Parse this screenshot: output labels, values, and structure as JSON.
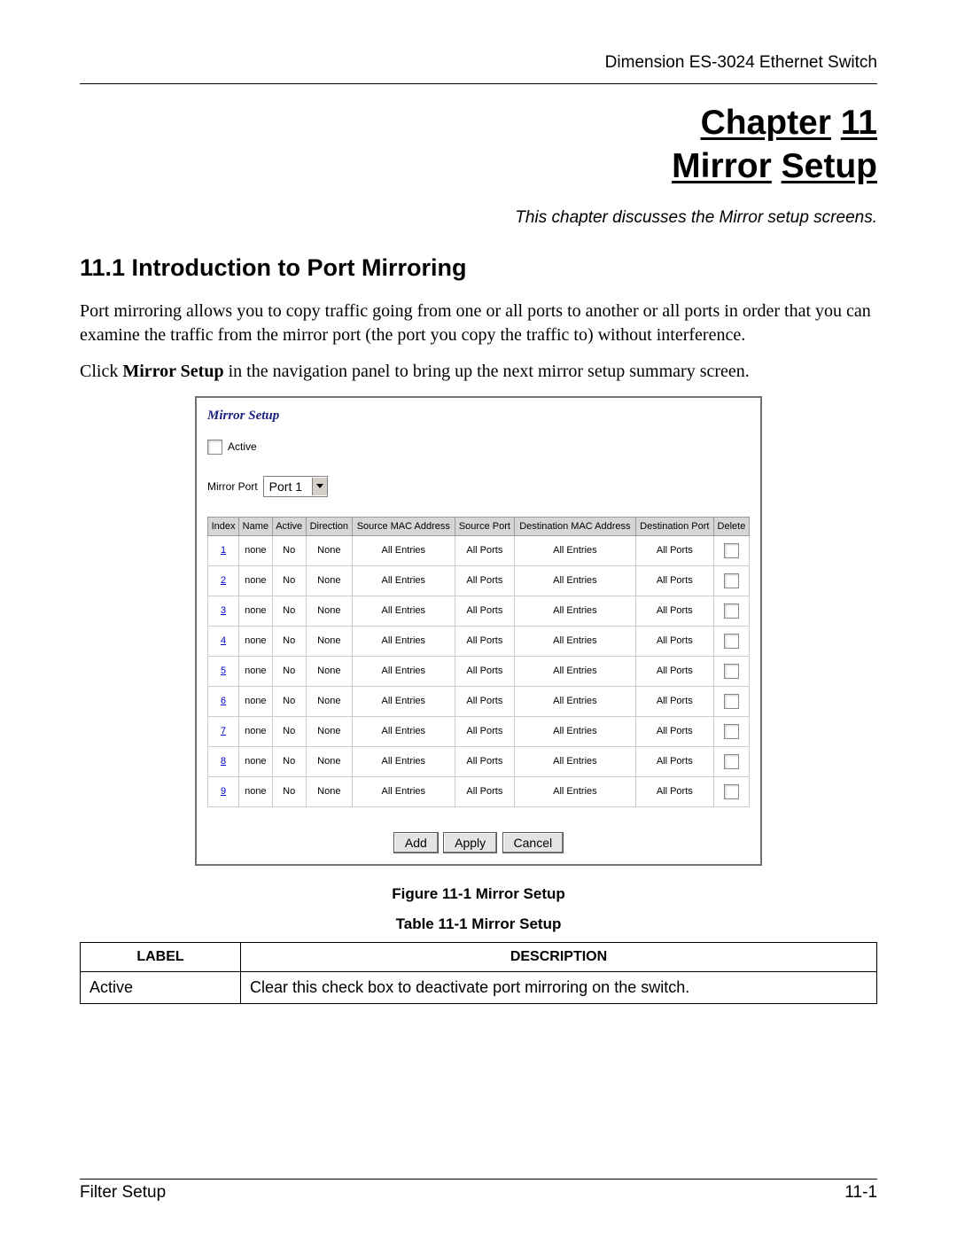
{
  "header": {
    "product": "Dimension ES-3024 Ethernet Switch"
  },
  "chapter": {
    "word_chapter": "Chapter",
    "number": "11",
    "title_a": "Mirror",
    "title_b": "Setup",
    "subtitle": "This chapter discusses the Mirror setup screens."
  },
  "section": {
    "heading": "11.1 Introduction to Port Mirroring",
    "p1": "Port mirroring allows you to copy traffic going from one or all ports to another or all ports in order that you can examine the traffic from the mirror port (the port you copy the traffic to) without interference.",
    "p2_pre": "Click ",
    "p2_bold": "Mirror Setup",
    "p2_post": " in the navigation panel to bring up the next mirror setup summary screen."
  },
  "screenshot": {
    "title": "Mirror Setup",
    "active_label": "Active",
    "mirror_port_label": "Mirror Port",
    "mirror_port_value": "Port 1",
    "columns": [
      "Index",
      "Name",
      "Active",
      "Direction",
      "Source MAC Address",
      "Source Port",
      "Destination MAC Address",
      "Destination Port",
      "Delete"
    ],
    "rows": [
      {
        "index": "1",
        "name": "none",
        "active": "No",
        "direction": "None",
        "srcmac": "All Entries",
        "srcport": "All Ports",
        "dstmac": "All Entries",
        "dstport": "All Ports"
      },
      {
        "index": "2",
        "name": "none",
        "active": "No",
        "direction": "None",
        "srcmac": "All Entries",
        "srcport": "All Ports",
        "dstmac": "All Entries",
        "dstport": "All Ports"
      },
      {
        "index": "3",
        "name": "none",
        "active": "No",
        "direction": "None",
        "srcmac": "All Entries",
        "srcport": "All Ports",
        "dstmac": "All Entries",
        "dstport": "All Ports"
      },
      {
        "index": "4",
        "name": "none",
        "active": "No",
        "direction": "None",
        "srcmac": "All Entries",
        "srcport": "All Ports",
        "dstmac": "All Entries",
        "dstport": "All Ports"
      },
      {
        "index": "5",
        "name": "none",
        "active": "No",
        "direction": "None",
        "srcmac": "All Entries",
        "srcport": "All Ports",
        "dstmac": "All Entries",
        "dstport": "All Ports"
      },
      {
        "index": "6",
        "name": "none",
        "active": "No",
        "direction": "None",
        "srcmac": "All Entries",
        "srcport": "All Ports",
        "dstmac": "All Entries",
        "dstport": "All Ports"
      },
      {
        "index": "7",
        "name": "none",
        "active": "No",
        "direction": "None",
        "srcmac": "All Entries",
        "srcport": "All Ports",
        "dstmac": "All Entries",
        "dstport": "All Ports"
      },
      {
        "index": "8",
        "name": "none",
        "active": "No",
        "direction": "None",
        "srcmac": "All Entries",
        "srcport": "All Ports",
        "dstmac": "All Entries",
        "dstport": "All Ports"
      },
      {
        "index": "9",
        "name": "none",
        "active": "No",
        "direction": "None",
        "srcmac": "All Entries",
        "srcport": "All Ports",
        "dstmac": "All Entries",
        "dstport": "All Ports"
      }
    ],
    "buttons": {
      "add": "Add",
      "apply": "Apply",
      "cancel": "Cancel"
    }
  },
  "figure_caption": "Figure 11-1 Mirror Setup",
  "table_caption": "Table 11-1 Mirror Setup",
  "desc_table": {
    "headers": [
      "LABEL",
      "DESCRIPTION"
    ],
    "rows": [
      {
        "label": "Active",
        "desc": "Clear this check box to deactivate port mirroring on the switch."
      }
    ]
  },
  "footer": {
    "left": "Filter Setup",
    "right": "11-1"
  }
}
